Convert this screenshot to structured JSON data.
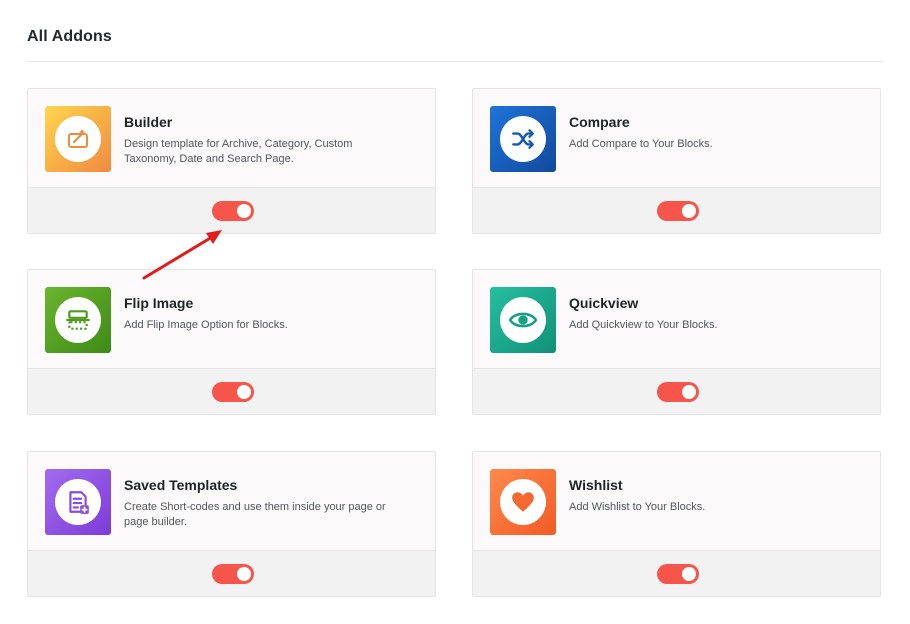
{
  "page": {
    "title": "All Addons"
  },
  "addons": [
    {
      "name": "Builder",
      "description": "Design template for Archive, Category, Custom Taxonomy, Date and Search Page.",
      "icon": "builder-icon",
      "enabled": true,
      "gradient": [
        "#ffd54f",
        "#f08a3e"
      ],
      "icon_color": "#f08a3e"
    },
    {
      "name": "Compare",
      "description": "Add Compare to Your Blocks.",
      "icon": "shuffle-icon",
      "enabled": true,
      "gradient": [
        "#1e73d8",
        "#114a9e"
      ],
      "icon_color": "#1659b8"
    },
    {
      "name": "Flip Image",
      "description": "Add Flip Image Option for Blocks.",
      "icon": "flip-image-icon",
      "enabled": true,
      "gradient": [
        "#6cb52f",
        "#3d8a16"
      ],
      "icon_color": "#4f9a1f"
    },
    {
      "name": "Quickview",
      "description": "Add Quickview to Your Blocks.",
      "icon": "eye-icon",
      "enabled": true,
      "gradient": [
        "#26bfa0",
        "#119077"
      ],
      "icon_color": "#16a085"
    },
    {
      "name": "Saved Templates",
      "description": "Create Short-codes and use them inside your page or page builder.",
      "icon": "saved-templates-icon",
      "enabled": true,
      "gradient": [
        "#a36bf0",
        "#7c3bd8"
      ],
      "icon_color": "#8a4be0"
    },
    {
      "name": "Wishlist",
      "description": "Add Wishlist to Your Blocks.",
      "icon": "heart-icon",
      "enabled": true,
      "gradient": [
        "#ff8a4c",
        "#f25a24"
      ],
      "icon_color": "#f26a30"
    }
  ],
  "toggle_color": "#f5554a"
}
